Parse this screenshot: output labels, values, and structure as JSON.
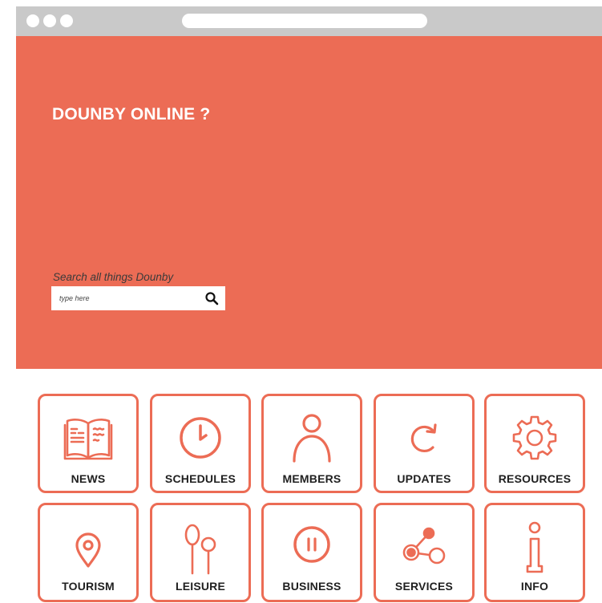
{
  "hero": {
    "title": "DOUNBY ONLINE ?",
    "search_label": "Search all things Dounby",
    "search_placeholder": "type here",
    "background_color": "#ec6c55"
  },
  "tiles": [
    {
      "label": "NEWS",
      "icon": "open-book-icon"
    },
    {
      "label": "SCHEDULES",
      "icon": "clock-icon"
    },
    {
      "label": "MEMBERS",
      "icon": "person-icon"
    },
    {
      "label": "UPDATES",
      "icon": "refresh-icon"
    },
    {
      "label": "RESOURCES",
      "icon": "gear-icon"
    },
    {
      "label": "TOURISM",
      "icon": "map-pin-icon"
    },
    {
      "label": "LEISURE",
      "icon": "balloons-icon"
    },
    {
      "label": "BUSINESS",
      "icon": "pause-circle-icon"
    },
    {
      "label": "SERVICES",
      "icon": "share-nodes-icon"
    },
    {
      "label": "INFO",
      "icon": "info-icon"
    }
  ],
  "colors": {
    "accent": "#ec6c55",
    "browser_chrome": "#c9c9c9"
  }
}
